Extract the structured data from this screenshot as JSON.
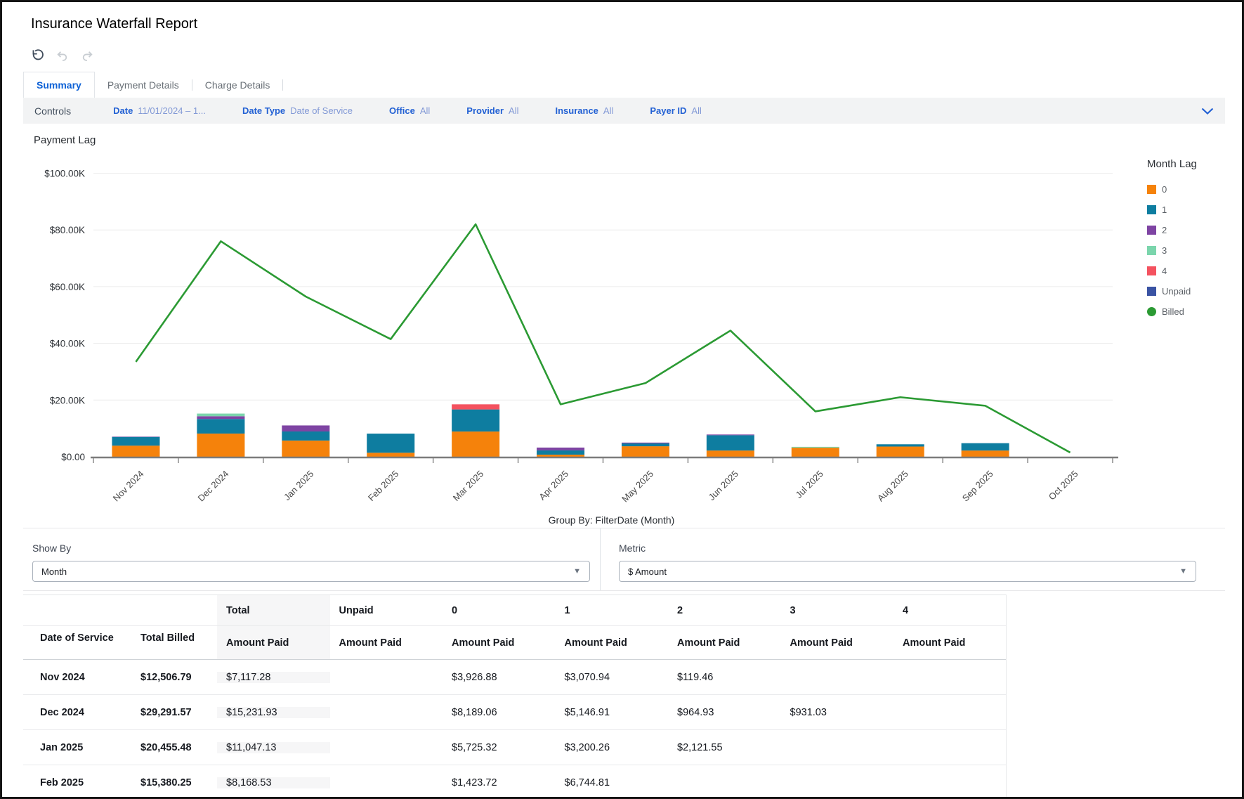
{
  "page": {
    "title": "Insurance Waterfall Report"
  },
  "toolbar": {
    "icons": [
      "refresh",
      "undo",
      "redo"
    ]
  },
  "tabs": [
    {
      "label": "Summary",
      "active": true
    },
    {
      "label": "Payment Details",
      "active": false
    },
    {
      "label": "Charge Details",
      "active": false
    }
  ],
  "controls": {
    "label": "Controls",
    "filters": [
      {
        "name": "Date",
        "value": "11/01/2024 – 1..."
      },
      {
        "name": "Date Type",
        "value": "Date of Service"
      },
      {
        "name": "Office",
        "value": "All"
      },
      {
        "name": "Provider",
        "value": "All"
      },
      {
        "name": "Insurance",
        "value": "All"
      },
      {
        "name": "Payer ID",
        "value": "All"
      }
    ],
    "expand_icon": "chevron-down"
  },
  "chart_data": {
    "type": "combo: stacked bar + line",
    "title": "Payment Lag",
    "caption": "Group By: FilterDate (Month)",
    "legend_title": "Month Lag",
    "legend_position": "right",
    "grid": true,
    "ylim": [
      0,
      100000
    ],
    "y_ticks": [
      {
        "value": 0,
        "label": "$0.00"
      },
      {
        "value": 20000,
        "label": "$20.00K"
      },
      {
        "value": 40000,
        "label": "$40.00K"
      },
      {
        "value": 60000,
        "label": "$60.00K"
      },
      {
        "value": 80000,
        "label": "$80.00K"
      },
      {
        "value": 100000,
        "label": "$100.00K"
      }
    ],
    "categories": [
      "Nov 2024",
      "Dec 2024",
      "Jan 2025",
      "Feb 2025",
      "Mar 2025",
      "Apr 2025",
      "May 2025",
      "Jun 2025",
      "Jul 2025",
      "Aug 2025",
      "Sep 2025",
      "Oct 2025"
    ],
    "bar_series": [
      {
        "name": "0",
        "color": "#F5820B",
        "values": [
          3926.88,
          8189.06,
          5725.32,
          1423.72,
          8900,
          750,
          3700,
          2200,
          3200,
          3600,
          2200,
          0
        ]
      },
      {
        "name": "1",
        "color": "#0E7DA0",
        "values": [
          3070.94,
          5146.91,
          3200.26,
          6744.81,
          7800,
          1500,
          1000,
          5400,
          0,
          800,
          2600,
          0
        ]
      },
      {
        "name": "2",
        "color": "#7E44A3",
        "values": [
          119.46,
          964.93,
          2121.55,
          0,
          0,
          1000,
          300,
          250,
          0,
          0,
          0,
          0
        ]
      },
      {
        "name": "3",
        "color": "#7BD5AC",
        "values": [
          0,
          931.03,
          0,
          0,
          0,
          0,
          0,
          0,
          300,
          0,
          0,
          0
        ]
      },
      {
        "name": "4",
        "color": "#F4525F",
        "values": [
          0,
          0,
          0,
          0,
          1800,
          0,
          0,
          0,
          0,
          0,
          0,
          0
        ]
      },
      {
        "name": "Unpaid",
        "color": "#3A53A3",
        "values": [
          0,
          0,
          0,
          0,
          0,
          0,
          0,
          0,
          0,
          0,
          0,
          0
        ]
      }
    ],
    "line_series": {
      "name": "Billed",
      "color": "#2B9A33",
      "values": [
        33500,
        76000,
        56500,
        41500,
        82000,
        18500,
        26000,
        44500,
        16000,
        21000,
        18000,
        1500
      ]
    }
  },
  "show_by": {
    "label": "Show By",
    "value": "Month"
  },
  "metric": {
    "label": "Metric",
    "value": "$ Amount"
  },
  "table": {
    "left_headers": [
      "Date of Service",
      "Total Billed"
    ],
    "group_headers": [
      "Total",
      "Unpaid",
      "0",
      "1",
      "2",
      "3",
      "4"
    ],
    "sub_header": "Amount Paid",
    "shaded_group": "Total",
    "rows": [
      {
        "month": "Nov 2024",
        "billed": "$12,506.79",
        "paid": [
          "$7,117.28",
          "",
          "$3,926.88",
          "$3,070.94",
          "$119.46",
          "",
          ""
        ]
      },
      {
        "month": "Dec 2024",
        "billed": "$29,291.57",
        "paid": [
          "$15,231.93",
          "",
          "$8,189.06",
          "$5,146.91",
          "$964.93",
          "$931.03",
          ""
        ]
      },
      {
        "month": "Jan 2025",
        "billed": "$20,455.48",
        "paid": [
          "$11,047.13",
          "",
          "$5,725.32",
          "$3,200.26",
          "$2,121.55",
          "",
          ""
        ]
      },
      {
        "month": "Feb 2025",
        "billed": "$15,380.25",
        "paid": [
          "$8,168.53",
          "",
          "$1,423.72",
          "$6,744.81",
          "",
          "",
          ""
        ]
      }
    ]
  }
}
